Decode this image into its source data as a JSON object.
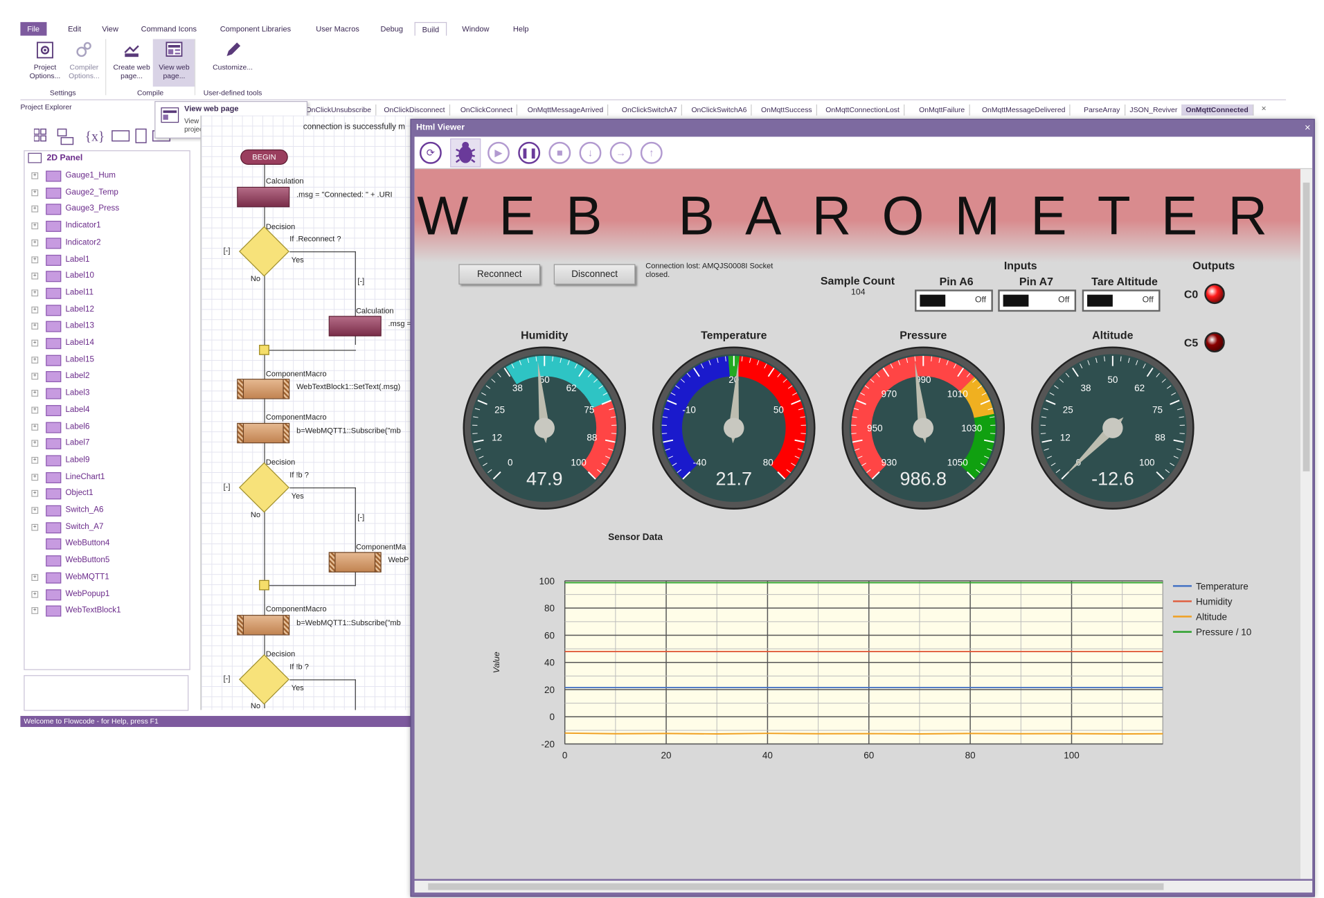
{
  "menu": {
    "items": [
      "File",
      "Edit",
      "View",
      "Command Icons",
      "Component Libraries",
      "User Macros",
      "Debug",
      "Build",
      "Window",
      "Help"
    ],
    "active": "Build"
  },
  "ribbon": {
    "buttons": [
      {
        "label": "Project\nOptions...",
        "icon": "gear-doc-icon"
      },
      {
        "label": "Compiler\nOptions...",
        "icon": "gears-icon"
      },
      {
        "label": "Create web\npage...",
        "icon": "web-create-icon"
      },
      {
        "label": "View web\npage...",
        "icon": "web-view-icon"
      },
      {
        "label": "Customize...",
        "icon": "pencil-icon"
      }
    ],
    "groups": [
      "Settings",
      "Compile",
      "User-defined tools"
    ]
  },
  "tooltip": {
    "title": "View web page",
    "text": "View the created a web page for the project"
  },
  "explorer": {
    "title": "Project Explorer",
    "root": "2D Panel",
    "items": [
      "Gauge1_Hum",
      "Gauge2_Temp",
      "Gauge3_Press",
      "Indicator1",
      "Indicator2",
      "Label1",
      "Label10",
      "Label11",
      "Label12",
      "Label13",
      "Label14",
      "Label15",
      "Label2",
      "Label3",
      "Label4",
      "Label6",
      "Label7",
      "Label9",
      "LineChart1",
      "Object1",
      "Switch_A6",
      "Switch_A7",
      "WebButton4",
      "WebButton5",
      "WebMQTT1",
      "WebPopup1",
      "WebTextBlock1"
    ]
  },
  "status": "Welcome to Flowcode - for Help, press F1",
  "macro_tabs": [
    "OnClickUnsubscribe",
    "OnClickDisconnect",
    "OnClickConnect",
    "OnMqttMessageArrived",
    "OnClickSwitchA7",
    "OnClickSwitchA6",
    "OnMqttSuccess",
    "OnMqttConnectionLost",
    "OnMqttFailure",
    "OnMqttMessageDelivered",
    "ParseArray",
    "JSON_Reviver",
    "OnMqttConnected"
  ],
  "flow": {
    "description": "connection is successfully m",
    "begin": "BEGIN",
    "calc1_title": "Calculation",
    "calc1_text": ".msg = \"Connected: \" + .URI",
    "dec1_title": "Decision",
    "dec1_text": "If .Reconnect ?",
    "yes": "Yes",
    "no": "No",
    "collapse": "[-]",
    "calc2_title": "Calculation",
    "calc2_text": ".msg =",
    "macro1_title": "ComponentMacro",
    "macro1_text": "WebTextBlock1::SetText(.msg)",
    "macro2_title": "ComponentMacro",
    "macro2_text": "b=WebMQTT1::Subscribe(\"mb",
    "dec2_title": "Decision",
    "dec2_text": "If !b ?",
    "macro3_title": "ComponentMa",
    "macro3_text": "WebP",
    "macro4_title": "ComponentMacro",
    "macro4_text": "b=WebMQTT1::Subscribe(\"mb",
    "dec3_title": "Decision",
    "dec3_text": "If !b ?"
  },
  "viewer": {
    "title": "Html Viewer",
    "close": "×",
    "toolbar": [
      "refresh-icon",
      "debug-icon",
      "play-icon",
      "pause-icon",
      "stop-icon",
      "step-into-icon",
      "step-over-icon",
      "step-out-icon"
    ],
    "app_title": "WEB BAROMETER",
    "reconnect": "Reconnect",
    "disconnect": "Disconnect",
    "connection_msg": "Connection lost: AMQJS0008I Socket closed.",
    "sample_count_label": "Sample Count",
    "sample_count": "104",
    "inputs_label": "Inputs",
    "pin_a6": "Pin A6",
    "pin_a7": "Pin A7",
    "tare": "Tare Altitude",
    "switch_state": "Off",
    "outputs_label": "Outputs",
    "c0": "C0",
    "c5": "C5",
    "led_c0_color": "#ff1a1a",
    "led_c5_color": "#8a0000",
    "gauges": [
      {
        "title": "Humidity",
        "value": 47.9,
        "display": "47.9",
        "min": 0,
        "max": 100,
        "ticks": [
          "0",
          "12",
          "25",
          "38",
          "50",
          "62",
          "75",
          "88",
          "100"
        ],
        "bands": [
          {
            "from": 38,
            "to": 75,
            "color": "#2ec4c4"
          },
          {
            "from": 75,
            "to": 100,
            "color": "#ff4545"
          }
        ]
      },
      {
        "title": "Temperature",
        "value": 21.7,
        "display": "21.7",
        "min": -40,
        "max": 80,
        "ticks": [
          "-40",
          "-10",
          "20",
          "50",
          "80"
        ],
        "bands": [
          {
            "from": -40,
            "to": 18,
            "color": "#1a1acc"
          },
          {
            "from": 18,
            "to": 22,
            "color": "#22aa22"
          },
          {
            "from": 22,
            "to": 80,
            "color": "#ff0000"
          }
        ]
      },
      {
        "title": "Pressure",
        "value": 986.8,
        "display": "986.8",
        "min": 930,
        "max": 1050,
        "ticks": [
          "930",
          "950",
          "970",
          "990",
          "1010",
          "1030",
          "1050"
        ],
        "bands": [
          {
            "from": 930,
            "to": 1010,
            "color": "#ff4545"
          },
          {
            "from": 1010,
            "to": 1025,
            "color": "#f0b020"
          },
          {
            "from": 1025,
            "to": 1050,
            "color": "#10a010"
          }
        ]
      },
      {
        "title": "Altitude",
        "value": -12.6,
        "display": "-12.6",
        "min": 0,
        "max": 100,
        "ticks": [
          "0",
          "12",
          "25",
          "38",
          "50",
          "62",
          "75",
          "88",
          "100"
        ],
        "bands": []
      }
    ]
  },
  "chart_data": {
    "type": "line",
    "title": "Sensor Data",
    "xlabel": "",
    "ylabel": "Value",
    "xlim": [
      0,
      118
    ],
    "ylim": [
      -20,
      100
    ],
    "xticks": [
      0,
      20,
      40,
      60,
      80,
      100
    ],
    "yticks": [
      -20,
      0,
      20,
      40,
      60,
      80,
      100
    ],
    "grid": true,
    "legend_position": "right",
    "series": [
      {
        "name": "Temperature",
        "color": "#4472c4",
        "x": [
          0,
          118
        ],
        "y": [
          21.5,
          21.5
        ]
      },
      {
        "name": "Humidity",
        "color": "#e05a3a",
        "x": [
          0,
          118
        ],
        "y": [
          48,
          48
        ]
      },
      {
        "name": "Altitude",
        "color": "#f0a020",
        "x": [
          0,
          10,
          20,
          30,
          40,
          50,
          60,
          70,
          80,
          90,
          100,
          110,
          118
        ],
        "y": [
          -12,
          -12.5,
          -12.3,
          -12.6,
          -12.2,
          -12.5,
          -12.4,
          -12.6,
          -12.3,
          -12.5,
          -12.4,
          -12.6,
          -12.5
        ]
      },
      {
        "name": "Pressure / 10",
        "color": "#2aa02a",
        "x": [
          0,
          118
        ],
        "y": [
          98.7,
          98.7
        ]
      }
    ]
  }
}
